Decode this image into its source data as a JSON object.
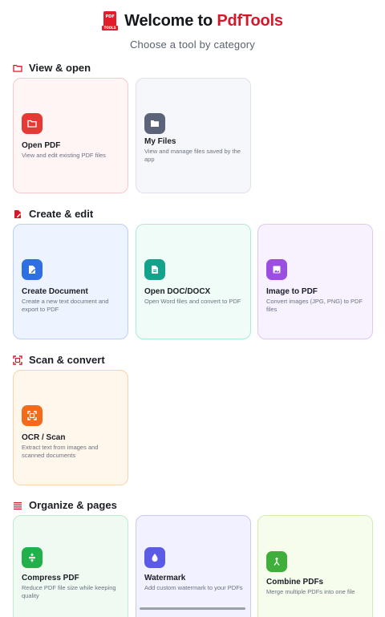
{
  "header": {
    "logo_text_top": "PDF",
    "logo_text_bottom": "TOOLS",
    "title_prefix": "Welcome to ",
    "title_brand": "PdfTools",
    "subtitle": "Choose a tool by category"
  },
  "sections": [
    {
      "title": "View & open",
      "icon": "folder-outline-icon",
      "tools": [
        {
          "title": "Open PDF",
          "desc": "View and edit existing PDF files",
          "icon": "folder-icon",
          "color": "#e53935"
        },
        {
          "title": "My Files",
          "desc": "View and manage files saved by the app",
          "icon": "folder-icon",
          "color": "#5b6478"
        }
      ]
    },
    {
      "title": "Create & edit",
      "icon": "edit-document-icon",
      "tools": [
        {
          "title": "Create Document",
          "desc": "Create a new text document and export to PDF",
          "icon": "edit-document-icon",
          "color": "#2f6fe4"
        },
        {
          "title": "Open DOC/DOCX",
          "desc": "Open Word files and convert to PDF",
          "icon": "document-icon",
          "color": "#13a38a"
        },
        {
          "title": "Image to PDF",
          "desc": "Convert images (JPG, PNG) to PDF files",
          "icon": "image-icon",
          "color": "#9b4ee0"
        }
      ]
    },
    {
      "title": "Scan & convert",
      "icon": "scan-icon",
      "tools": [
        {
          "title": "OCR / Scan",
          "desc": "Extract text from images and scanned documents",
          "icon": "scan-icon",
          "color": "#f26b1d"
        }
      ]
    },
    {
      "title": "Organize & pages",
      "icon": "list-icon",
      "tools": [
        {
          "title": "Compress PDF",
          "desc": "Reduce PDF file size while keeping quality",
          "icon": "compress-icon",
          "color": "#22b04b"
        },
        {
          "title": "Watermark",
          "desc": "Add custom watermark to your PDFs",
          "icon": "droplet-icon",
          "color": "#5b5be6"
        },
        {
          "title": "Combine PDFs",
          "desc": "Merge multiple PDFs into one file",
          "icon": "merge-icon",
          "color": "#3fae3a"
        }
      ]
    }
  ],
  "colors": {
    "brand": "#d5182a",
    "section_icon": "#d5182a"
  }
}
